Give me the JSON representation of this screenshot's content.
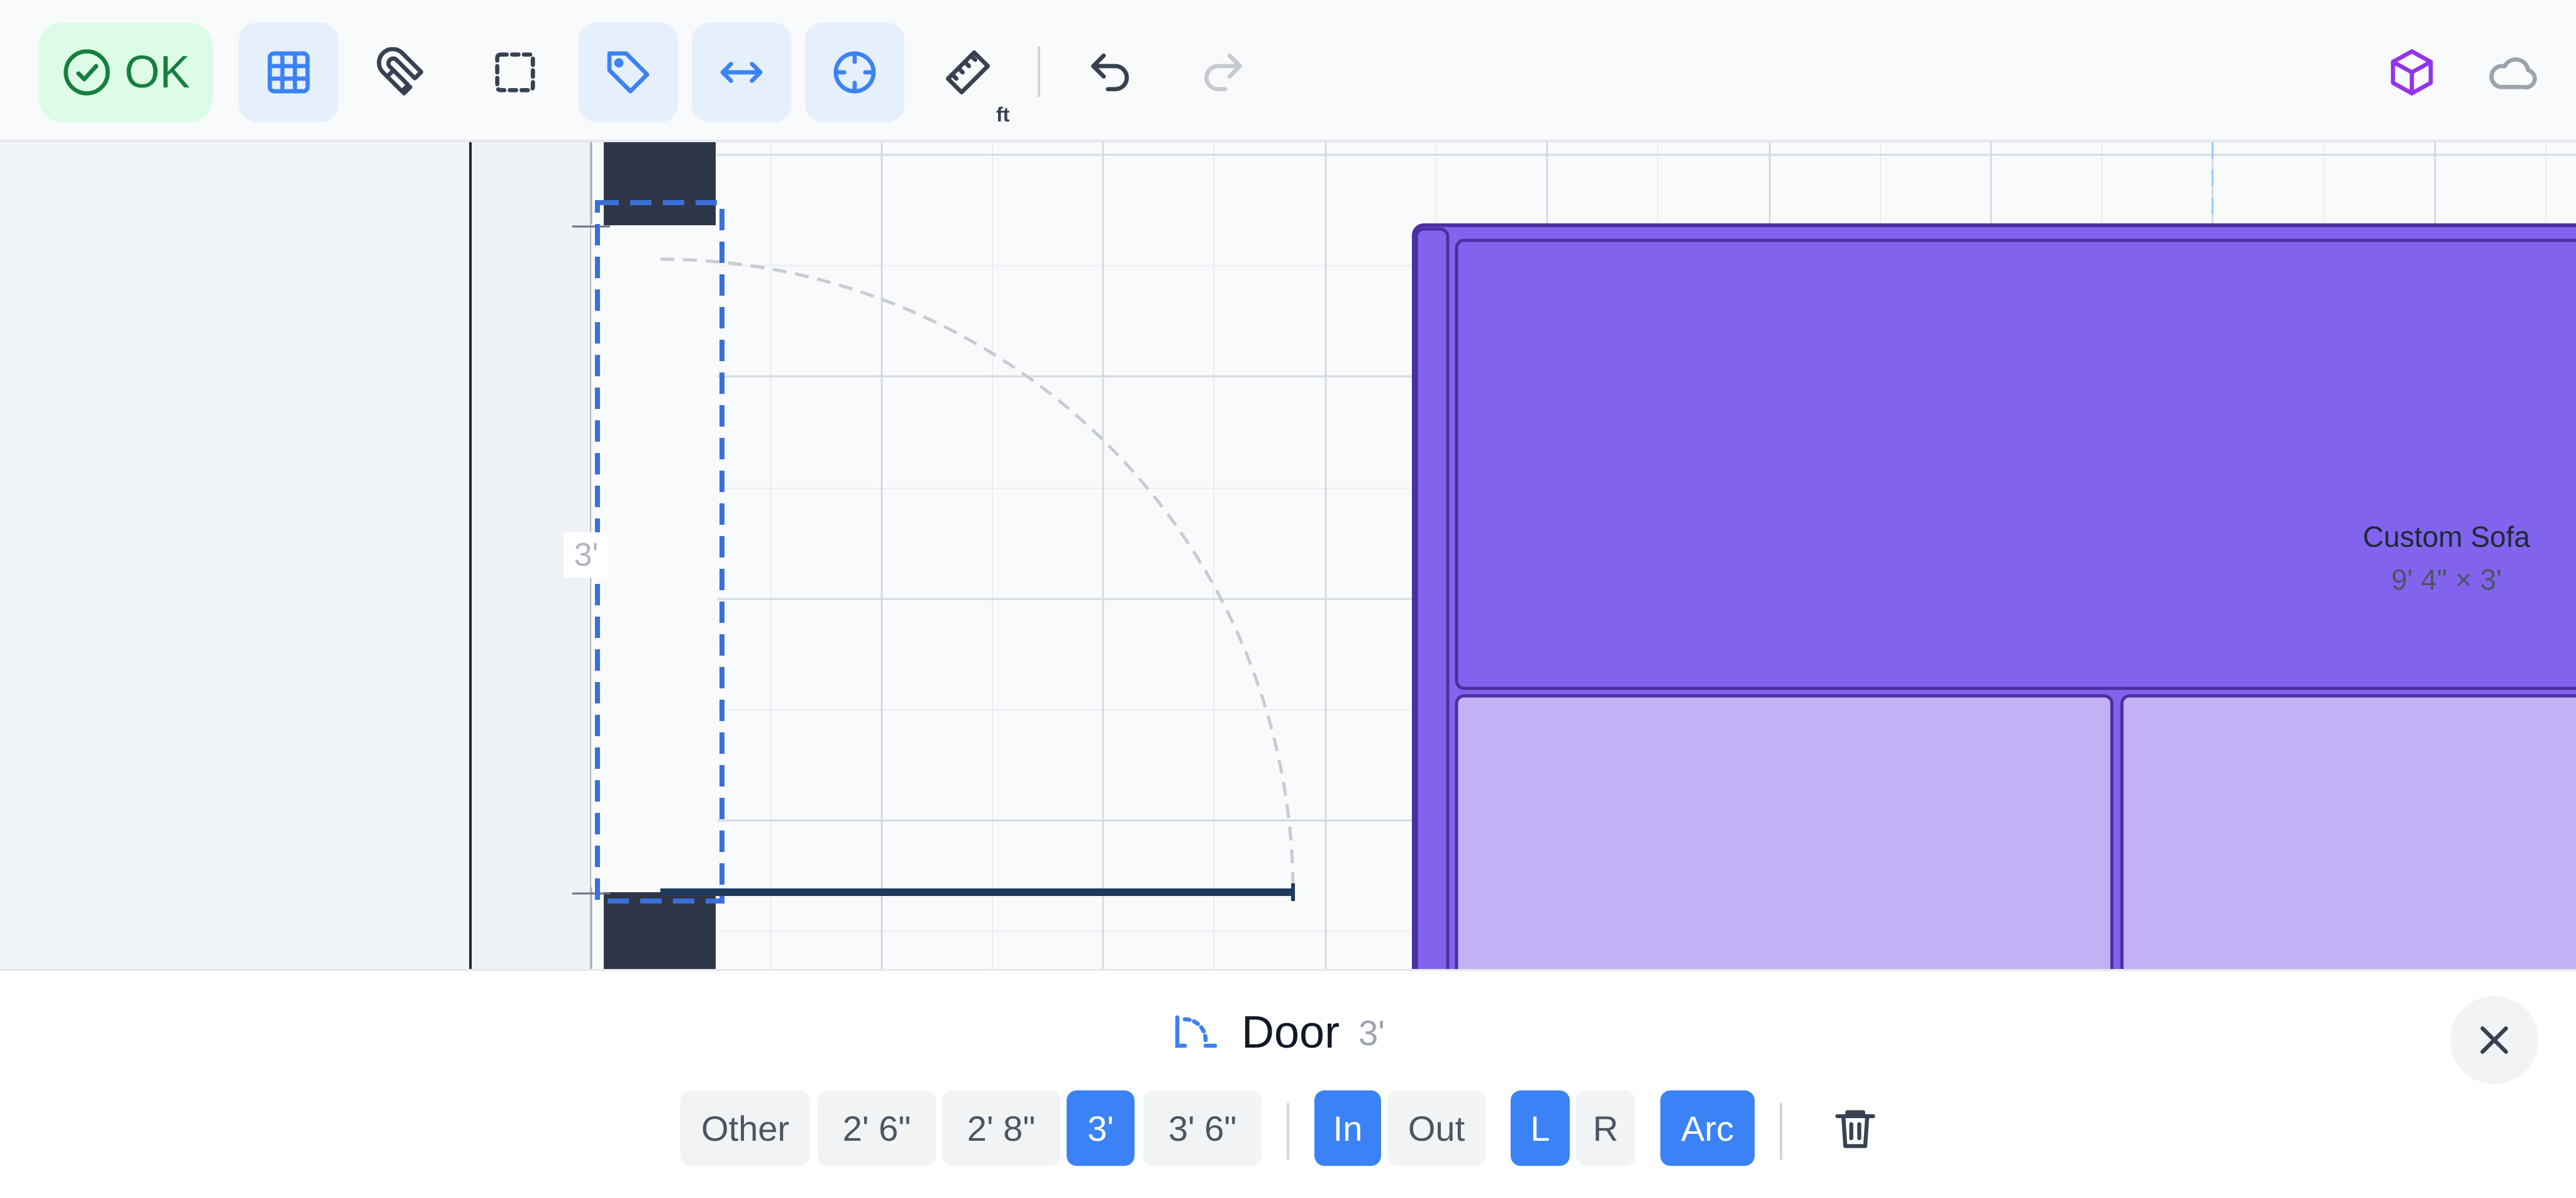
{
  "toolbar": {
    "ok_label": "OK",
    "unit_label": "ft",
    "icons": [
      "check-circle-icon",
      "grid-icon",
      "magnet-icon",
      "select-rect-icon",
      "tag-icon",
      "arrows-h-icon",
      "crosshair-icon",
      "ruler-icon",
      "undo-icon",
      "redo-icon",
      "cube-icon",
      "cloud-icon"
    ],
    "colors": {
      "ok_bg": "#dcfce7",
      "ok_text": "#15803d",
      "active_bg": "#e6effc",
      "accent": "#3b82f6",
      "cube": "#9333ea"
    }
  },
  "canvas": {
    "door_width_label": "3'",
    "sofa": {
      "name": "Custom Sofa",
      "dims": "9' 4\" × 3'",
      "colors": {
        "frame": "#8263ed",
        "cushion_light": "#c2b2f5",
        "outline": "#4c2fa0"
      }
    },
    "wall_color": "#2d3748",
    "selection_color": "#3b6fd8"
  },
  "panel": {
    "title": "Door",
    "size": "3'",
    "width_options": [
      {
        "label": "Other",
        "selected": false
      },
      {
        "label": "2' 6\"",
        "selected": false
      },
      {
        "label": "2' 8\"",
        "selected": false
      },
      {
        "label": "3'",
        "selected": true
      },
      {
        "label": "3' 6\"",
        "selected": false
      }
    ],
    "swing_options": [
      {
        "label": "In",
        "selected": true
      },
      {
        "label": "Out",
        "selected": false
      }
    ],
    "hinge_options": [
      {
        "label": "L",
        "selected": true
      },
      {
        "label": "R",
        "selected": false
      }
    ],
    "style_options": [
      {
        "label": "Arc",
        "selected": true
      }
    ]
  }
}
